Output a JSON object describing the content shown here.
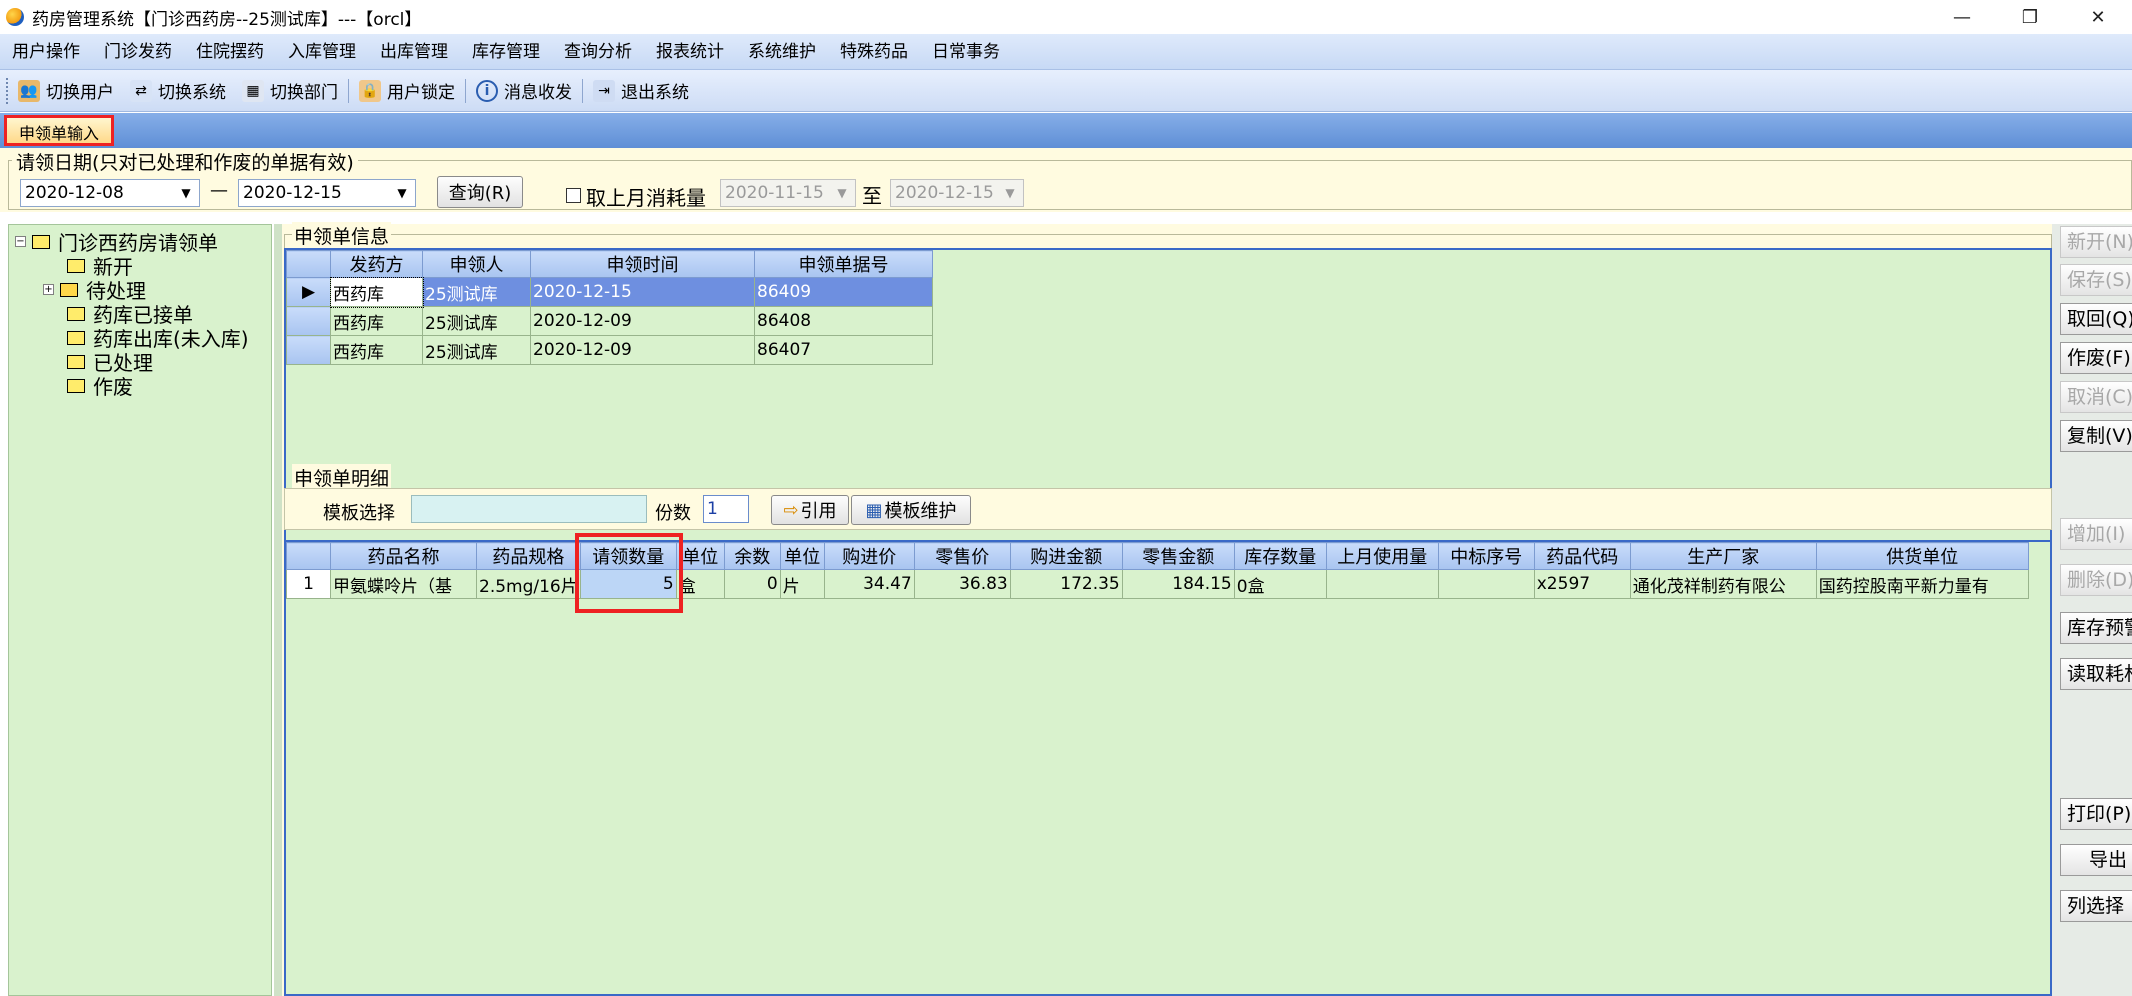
{
  "window": {
    "title": "药房管理系统【门诊西药房--25测试库】---【orcl】",
    "minimize": "—",
    "restore": "❐",
    "close": "✕"
  },
  "menu": [
    "用户操作",
    "门诊发药",
    "住院摆药",
    "入库管理",
    "出库管理",
    "库存管理",
    "查询分析",
    "报表统计",
    "系统维护",
    "特殊药品",
    "日常事务"
  ],
  "toolbar": {
    "switch_user": "切换用户",
    "switch_system": "切换系统",
    "switch_dept": "切换部门",
    "user_lock": "用户锁定",
    "message": "消息收发",
    "exit": "退出系统"
  },
  "tab": {
    "label": "申领单输入"
  },
  "filter": {
    "legend": "请领日期(只对已处理和作废的单据有效)",
    "date_from": "2020-12-08",
    "dash": "—",
    "date_to": "2020-12-15",
    "query_button": "查询(R)",
    "last_month_label": "取上月消耗量",
    "last_from": "2020-11-15",
    "to_label": "至",
    "last_to": "2020-12-15"
  },
  "tree": {
    "root": "门诊西药房请领单",
    "items": [
      "新开",
      "待处理",
      "药库已接单",
      "药库出库(未入库)",
      "已处理",
      "作废"
    ]
  },
  "info_section": {
    "title": "申领单信息",
    "columns": [
      "发药方",
      "申领人",
      "申领时间",
      "申领单据号"
    ],
    "rows": [
      [
        "西药库",
        "25测试库",
        "2020-12-15",
        "86409"
      ],
      [
        "西药库",
        "25测试库",
        "2020-12-09",
        "86408"
      ],
      [
        "西药库",
        "25测试库",
        "2020-12-09",
        "86407"
      ]
    ]
  },
  "detail_section": {
    "title": "申领单明细",
    "template_label": "模板选择",
    "copies_label": "份数",
    "copies_value": "1",
    "ref_button": "引用",
    "template_button": "模板维护",
    "columns": [
      "药品名称",
      "药品规格",
      "请领数量",
      "单位",
      "余数",
      "单位",
      "购进价",
      "零售价",
      "购进金额",
      "零售金额",
      "库存数量",
      "上月使用量",
      "中标序号",
      "药品代码",
      "生产厂家",
      "供货单位"
    ],
    "rows": [
      [
        "1",
        "甲氨蝶呤片（基",
        "2.5mg/16片",
        "5",
        "盒",
        "0",
        "片",
        "34.47",
        "36.83",
        "172.35",
        "184.15",
        "0盒",
        "",
        "",
        "x2597",
        "通化茂祥制药有限公",
        "国药控股南平新力量有"
      ]
    ]
  },
  "side_buttons": {
    "new": "新开(N)",
    "save": "保存(S)",
    "retrieve": "取回(Q)",
    "void": "作废(F)",
    "cancel": "取消(C)",
    "copy": "复制(V)",
    "add": "增加(I)",
    "delete": "删除(D)",
    "stock_warn": "库存预警",
    "read_consume": "读取耗材",
    "print": "打印(P)",
    "export": "导出",
    "col_select": "列选择"
  }
}
